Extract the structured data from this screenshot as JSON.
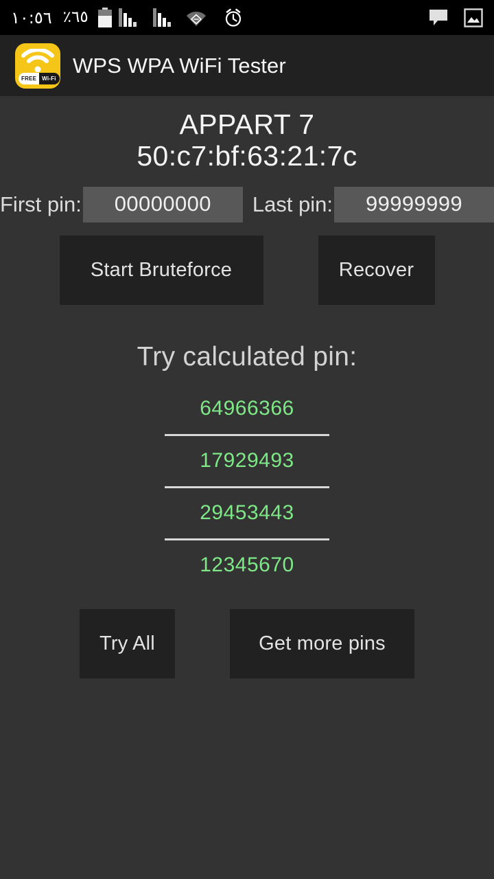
{
  "statusbar": {
    "clock": "١٠:٥٦",
    "battery_percent": "٪٦٥",
    "icons": {
      "battery": "battery-icon",
      "signal_sim1": "signal-bars-icon",
      "signal_sim2": "signal-bars-icon",
      "wifi": "wifi-icon",
      "alarm": "alarm-clock-icon",
      "message": "message-bubble-icon",
      "screenshot": "image-icon"
    }
  },
  "appbar": {
    "title": "WPS WPA WiFi Tester",
    "logo": {
      "badge_free": "FREE",
      "badge_wifi": "Wi-Fi",
      "accent_color": "#f5c518"
    }
  },
  "network": {
    "ssid": "APPART 7",
    "bssid": "50:c7:bf:63:21:7c"
  },
  "bruteforce": {
    "first_pin_label": "First pin:",
    "first_pin_value": "00000000",
    "first_pin_placeholder": "00000000",
    "last_pin_label": "Last pin:",
    "last_pin_value": "99999999",
    "last_pin_placeholder": "99999999",
    "start_button": "Start Bruteforce",
    "recover_button": "Recover"
  },
  "calculated": {
    "heading": "Try calculated pin:",
    "pin_color": "#7ee887",
    "pins": [
      "64966366",
      "17929493",
      "29453443",
      "12345670"
    ],
    "try_all_button": "Try All",
    "get_more_button": "Get more pins"
  },
  "theme": {
    "background": "#333333",
    "appbar_background": "#212121",
    "button_background": "#212121",
    "input_background": "#585858",
    "text_primary": "#f4f4f4",
    "text_secondary": "#d3d3d3"
  }
}
